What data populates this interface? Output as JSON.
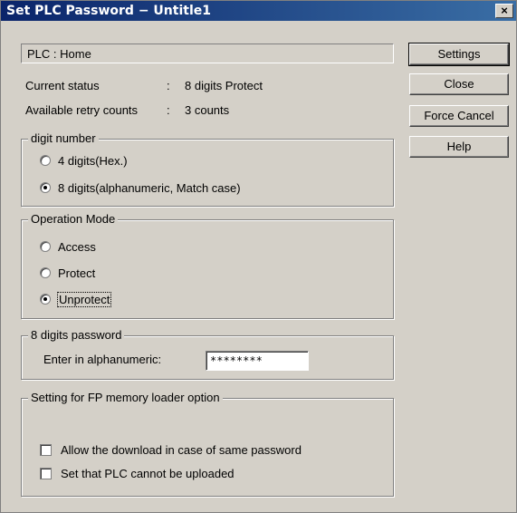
{
  "window": {
    "title": "Set PLC Password − Untitle1",
    "close_glyph": "×"
  },
  "plc": {
    "label": "PLC  :  Home"
  },
  "status": {
    "current_label": "Current status",
    "current_colon": ":",
    "current_value": "8 digits Protect",
    "retry_label": "Available retry counts",
    "retry_colon": ":",
    "retry_value": "3 counts"
  },
  "digit_group": {
    "legend": "digit number",
    "options": [
      {
        "label": "4 digits(Hex.)",
        "selected": false
      },
      {
        "label": "8 digits(alphanumeric, Match case)",
        "selected": true
      }
    ]
  },
  "mode_group": {
    "legend": "Operation Mode",
    "options": [
      {
        "label": "Access",
        "selected": false
      },
      {
        "label": "Protect",
        "selected": false
      },
      {
        "label": "Unprotect",
        "selected": true
      }
    ]
  },
  "password_group": {
    "legend": "8 digits password",
    "label": "Enter in alphanumeric:",
    "value": "********"
  },
  "loader_group": {
    "legend": "Setting for FP memory loader option",
    "options": [
      {
        "label": "Allow the download in case of same password",
        "checked": false
      },
      {
        "label": "Set that PLC cannot be uploaded",
        "checked": false
      }
    ]
  },
  "buttons": {
    "settings": "Settings",
    "close": "Close",
    "force_cancel": "Force Cancel",
    "help": "Help"
  }
}
